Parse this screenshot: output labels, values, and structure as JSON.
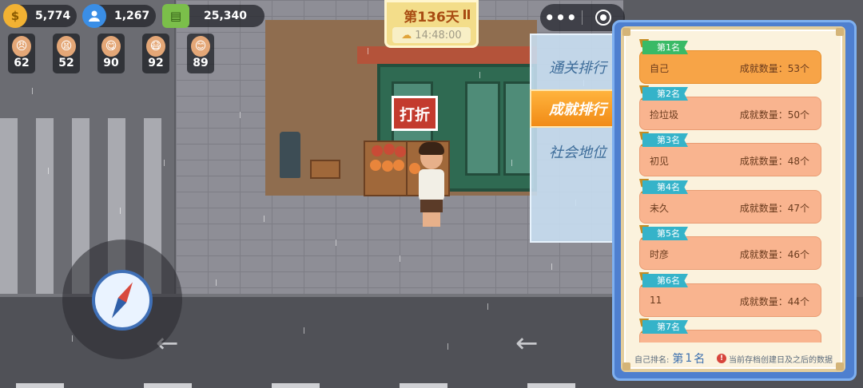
{
  "hud": {
    "gold": {
      "value": "5,774",
      "icon": "gold-coin-icon",
      "color": "#f2b233"
    },
    "followers": {
      "value": "1,267",
      "icon": "person-icon",
      "color": "#3a8ee6"
    },
    "cash": {
      "value": "25,340",
      "icon": "cash-stack-icon",
      "color": "#7bbf4a"
    },
    "stats": [
      {
        "value": "62",
        "icon": "angry-face-icon"
      },
      {
        "value": "52",
        "icon": "tired-face-icon"
      },
      {
        "value": "90",
        "icon": "eating-face-icon"
      },
      {
        "value": "92",
        "icon": "sick-face-icon"
      },
      {
        "value": "89",
        "icon": "happy-face-icon"
      }
    ]
  },
  "day_card": {
    "title": "第136天",
    "time": "14:48:00",
    "weather_icon": "rain-cloud-icon"
  },
  "scene": {
    "sale_sign": "打折"
  },
  "tabs": [
    {
      "label": "通关排行",
      "active": false
    },
    {
      "label": "成就排行",
      "active": true
    },
    {
      "label": "社会地位",
      "active": false
    }
  ],
  "ranking": {
    "items": [
      {
        "rank": "第1名",
        "name": "自己",
        "count": "成就数量：53个"
      },
      {
        "rank": "第2名",
        "name": "捡垃圾",
        "count": "成就数量：50个"
      },
      {
        "rank": "第3名",
        "name": "初见",
        "count": "成就数量：48个"
      },
      {
        "rank": "第4名",
        "name": "未久",
        "count": "成就数量：47个"
      },
      {
        "rank": "第5名",
        "name": "时彦",
        "count": "成就数量：46个"
      },
      {
        "rank": "第6名",
        "name": "11",
        "count": "成就数量：44个"
      },
      {
        "rank": "第7名",
        "name": "",
        "count": ""
      }
    ],
    "footer": {
      "own_rank_label": "自己排名:",
      "own_rank_prefix": "第",
      "own_rank_value": "1",
      "own_rank_suffix": "名",
      "notice": "当前存档创建日及之后的数据"
    }
  },
  "colors": {
    "accent_orange": "#f18b16",
    "panel_bg": "#fbf2dd",
    "badge_teal": "#35b3c9",
    "badge_green": "#39ba66"
  }
}
